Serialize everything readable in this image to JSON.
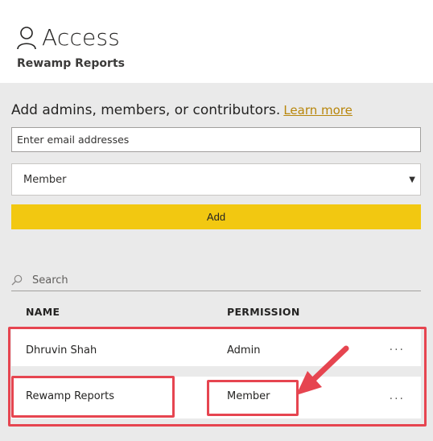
{
  "header": {
    "title": "Access",
    "subtitle": "Rewamp Reports",
    "icon": "person-icon"
  },
  "add_section": {
    "heading": "Add admins, members, or contributors.",
    "learn_more": "Learn more",
    "email_placeholder": "Enter email addresses",
    "role_selected": "Member",
    "add_label": "Add"
  },
  "search": {
    "placeholder": "Search",
    "icon": "search-icon"
  },
  "table": {
    "columns": [
      "NAME",
      "PERMISSION"
    ],
    "rows": [
      {
        "name": "Dhruvin Shah",
        "permission": "Admin",
        "more": "..."
      },
      {
        "name": "Rewamp Reports",
        "permission": "Member",
        "more": "..."
      }
    ]
  },
  "colors": {
    "accent": "#f2c811",
    "highlight": "#e64550",
    "panel_bg": "#eaeaea"
  }
}
